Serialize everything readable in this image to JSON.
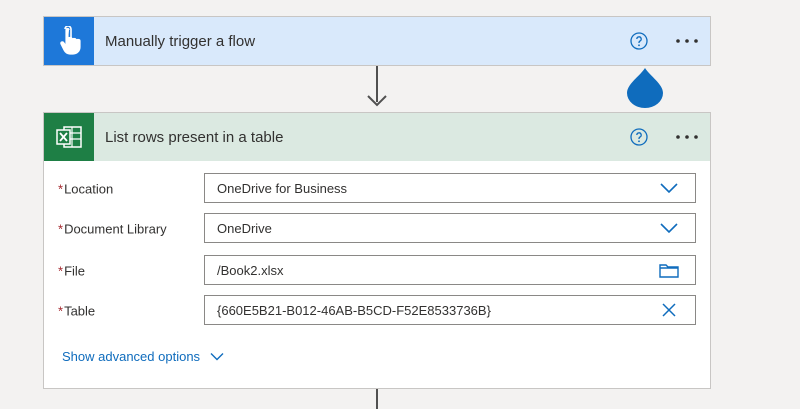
{
  "trigger": {
    "title": "Manually trigger a flow",
    "icon": "touch-hand-icon",
    "color": "#1e78d9",
    "header_bg": "#d9e9fb"
  },
  "action": {
    "title": "List rows present in a table",
    "icon": "excel-icon",
    "color": "#1e7f45",
    "header_bg": "#dbe9e1",
    "fields": [
      {
        "label": "Location",
        "required_mark": "*",
        "value": "OneDrive for Business",
        "control": "chevron-down-icon"
      },
      {
        "label": "Document Library",
        "required_mark": "*",
        "value": "OneDrive",
        "control": "chevron-down-icon"
      },
      {
        "label": "File",
        "required_mark": "*",
        "value": "/Book2.xlsx",
        "control": "folder-icon"
      },
      {
        "label": "Table",
        "required_mark": "*",
        "value": "{660E5B21-B012-46AB-B5CD-F52E8533736B}",
        "control": "close-icon"
      }
    ],
    "advanced_label": "Show advanced options"
  },
  "colors": {
    "accent": "#0f6cbd",
    "required": "#a4262c"
  }
}
